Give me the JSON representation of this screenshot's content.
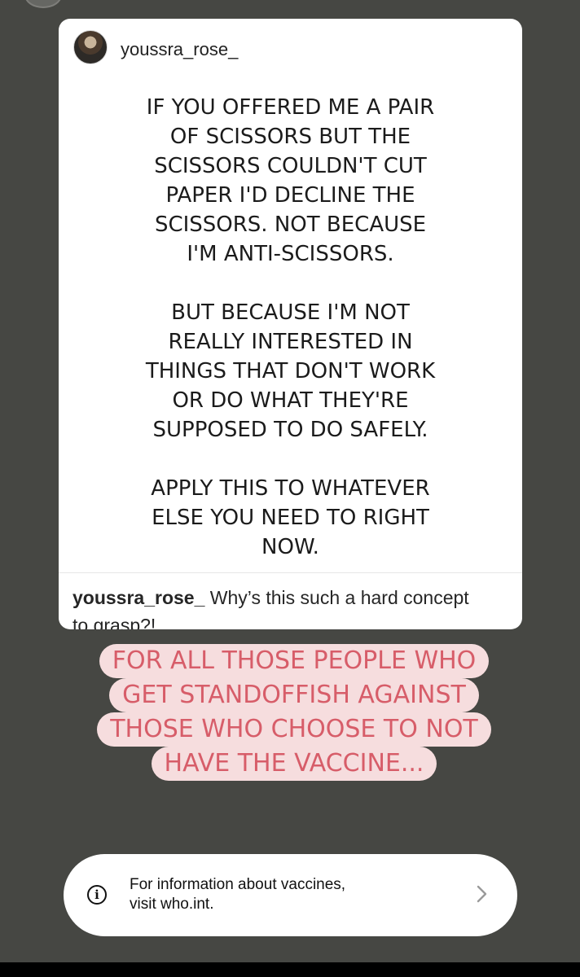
{
  "header": {
    "username": "youssra_rose_"
  },
  "quote": {
    "text": "IF YOU OFFERED ME A PAIR\nOF SCISSORS BUT THE\nSCISSORS COULDN'T CUT\nPAPER I'D DECLINE THE\nSCISSORS. NOT BECAUSE\nI'M ANTI-SCISSORS.\n\nBUT BECAUSE I'M NOT\nREALLY INTERESTED IN\nTHINGS THAT DON'T WORK\nOR DO WHAT THEY'RE\nSUPPOSED TO DO SAFELY.\n\nAPPLY THIS TO WHATEVER\nELSE YOU NEED TO RIGHT\nNOW."
  },
  "caption": {
    "user": "youssra_rose_",
    "text": "Why’s this such a hard concept to grasp?!"
  },
  "highlight": {
    "lines": [
      "FOR ALL THOSE PEOPLE WHO",
      "GET STANDOFFISH AGAINST",
      "THOSE WHO CHOOSE TO NOT",
      "HAVE THE VACCINE..."
    ],
    "text_color": "#d75d69",
    "background_color": "#f6ddde"
  },
  "info_bar": {
    "text": "For information about vaccines,\nvisit who.int.",
    "icon": "info-icon",
    "action_icon": "chevron-right-icon"
  },
  "colors": {
    "background": "#464743",
    "card": "#ffffff",
    "bottom_bar": "#000000"
  }
}
